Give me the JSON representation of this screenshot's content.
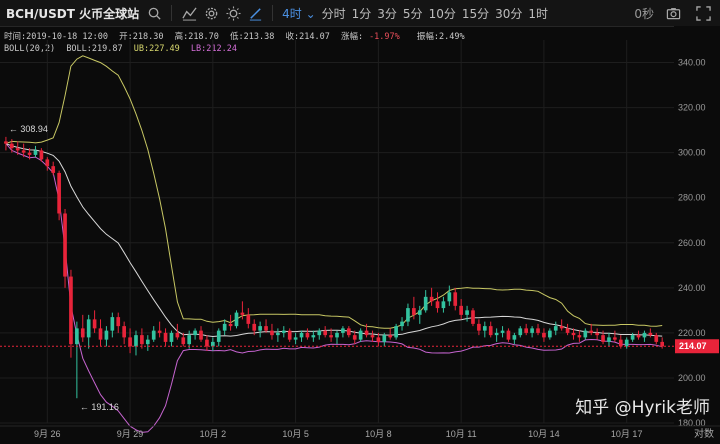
{
  "toolbar": {
    "symbol": "BCH/USDT 火币全球站",
    "intervals": [
      "4时",
      "分时",
      "1分",
      "3分",
      "5分",
      "10分",
      "15分",
      "30分",
      "1时"
    ],
    "countdown": "0秒",
    "icons": [
      "search-icon",
      "indicator-icon",
      "settings-icon",
      "theme-icon",
      "draw-icon",
      "camera-icon",
      "fullscreen-icon"
    ]
  },
  "info": {
    "time": "时间:2019-10-18 12:00",
    "open": "开:218.30",
    "high": "高:218.70",
    "low": "低:213.38",
    "close": "收:214.07",
    "change_label": "涨幅:",
    "change_value": "-1.97%",
    "amplitude": "振幅:2.49%",
    "boll_label": "BOLL(20,2)",
    "boll_mid": "BOLL:219.87",
    "boll_ub": "UB:227.49",
    "boll_lb": "LB:212.24"
  },
  "annotations": {
    "high_marker": "← 308.94",
    "low_marker": "← 191.16"
  },
  "current_price": "214.07",
  "watermark": "知乎 @Hyrik老师",
  "scale_button": "对数",
  "colors": {
    "up": "#33c3a0",
    "down": "#e8243a",
    "ub": "#c8c864",
    "lb": "#c664d0",
    "mid": "#d8d8d8",
    "active": "#4a90e2"
  },
  "chart_data": {
    "type": "candlestick",
    "ylim": [
      180,
      350
    ],
    "y_ticks": [
      "340.00",
      "320.00",
      "300.00",
      "280.00",
      "260.00",
      "240.00",
      "220.00",
      "200.00",
      "180.00"
    ],
    "x_labels": [
      "9月 26",
      "9月 29",
      "10月 2",
      "10月 5",
      "10月 8",
      "10月 11",
      "10月 14",
      "10月 17"
    ],
    "ohlc": [
      [
        305,
        307,
        301,
        304
      ],
      [
        304,
        306,
        300,
        302
      ],
      [
        302,
        305,
        299,
        301
      ],
      [
        301,
        304,
        298,
        300
      ],
      [
        300,
        302,
        297,
        299
      ],
      [
        299,
        303,
        298,
        301
      ],
      [
        301,
        302,
        296,
        297
      ],
      [
        297,
        298,
        292,
        294
      ],
      [
        294,
        296,
        290,
        291
      ],
      [
        291,
        292,
        270,
        273
      ],
      [
        273,
        275,
        240,
        245
      ],
      [
        245,
        248,
        209,
        215
      ],
      [
        215,
        225,
        191,
        222
      ],
      [
        222,
        228,
        216,
        218
      ],
      [
        218,
        228,
        213,
        226
      ],
      [
        226,
        230,
        220,
        222
      ],
      [
        222,
        226,
        214,
        217
      ],
      [
        217,
        223,
        214,
        221
      ],
      [
        221,
        229,
        218,
        227
      ],
      [
        227,
        229,
        220,
        223
      ],
      [
        223,
        225,
        215,
        218
      ],
      [
        218,
        222,
        211,
        214
      ],
      [
        214,
        221,
        210,
        219
      ],
      [
        219,
        222,
        213,
        215
      ],
      [
        215,
        219,
        212,
        217
      ],
      [
        217,
        223,
        216,
        221
      ],
      [
        221,
        225,
        218,
        220
      ],
      [
        220,
        222,
        214,
        216
      ],
      [
        216,
        221,
        214,
        220
      ],
      [
        220,
        224,
        217,
        218
      ],
      [
        218,
        220,
        214,
        215
      ],
      [
        215,
        221,
        213,
        219
      ],
      [
        219,
        222,
        217,
        221
      ],
      [
        221,
        223,
        216,
        217
      ],
      [
        217,
        219,
        212,
        214
      ],
      [
        214,
        218,
        212,
        216
      ],
      [
        216,
        222,
        214,
        221
      ],
      [
        221,
        226,
        219,
        224
      ],
      [
        224,
        228,
        221,
        223
      ],
      [
        223,
        230,
        222,
        229
      ],
      [
        229,
        234,
        226,
        228
      ],
      [
        228,
        231,
        222,
        224
      ],
      [
        224,
        226,
        219,
        221
      ],
      [
        221,
        225,
        218,
        223
      ],
      [
        223,
        226,
        220,
        221
      ],
      [
        221,
        224,
        217,
        219
      ],
      [
        219,
        222,
        216,
        220
      ],
      [
        220,
        223,
        218,
        221
      ],
      [
        221,
        222,
        216,
        217
      ],
      [
        217,
        220,
        215,
        218
      ],
      [
        218,
        221,
        216,
        220
      ],
      [
        220,
        222,
        217,
        218
      ],
      [
        218,
        221,
        216,
        219
      ],
      [
        219,
        222,
        217,
        221
      ],
      [
        221,
        223,
        218,
        219
      ],
      [
        219,
        222,
        216,
        218
      ],
      [
        218,
        221,
        215,
        220
      ],
      [
        220,
        223,
        218,
        222
      ],
      [
        222,
        223,
        218,
        219
      ],
      [
        219,
        221,
        215,
        217
      ],
      [
        217,
        222,
        216,
        221
      ],
      [
        221,
        224,
        218,
        219
      ],
      [
        219,
        221,
        216,
        218
      ],
      [
        218,
        220,
        214,
        216
      ],
      [
        216,
        220,
        214,
        219
      ],
      [
        219,
        222,
        217,
        218
      ],
      [
        218,
        224,
        217,
        223
      ],
      [
        223,
        227,
        221,
        225
      ],
      [
        225,
        233,
        223,
        231
      ],
      [
        231,
        236,
        226,
        228
      ],
      [
        228,
        232,
        224,
        230
      ],
      [
        230,
        239,
        229,
        236
      ],
      [
        236,
        240,
        232,
        234
      ],
      [
        234,
        238,
        229,
        231
      ],
      [
        231,
        236,
        229,
        234
      ],
      [
        234,
        241,
        232,
        238
      ],
      [
        238,
        240,
        230,
        232
      ],
      [
        232,
        235,
        226,
        228
      ],
      [
        228,
        232,
        225,
        230
      ],
      [
        230,
        231,
        223,
        224
      ],
      [
        224,
        226,
        219,
        221
      ],
      [
        221,
        225,
        218,
        223
      ],
      [
        223,
        225,
        218,
        219
      ],
      [
        219,
        222,
        216,
        220
      ],
      [
        220,
        223,
        218,
        221
      ],
      [
        221,
        222,
        216,
        217
      ],
      [
        217,
        220,
        215,
        219
      ],
      [
        219,
        223,
        218,
        222
      ],
      [
        222,
        224,
        219,
        220
      ],
      [
        220,
        223,
        218,
        222
      ],
      [
        222,
        224,
        219,
        220
      ],
      [
        220,
        222,
        216,
        218
      ],
      [
        218,
        222,
        217,
        221
      ],
      [
        221,
        225,
        219,
        223
      ],
      [
        223,
        226,
        221,
        222
      ],
      [
        222,
        224,
        219,
        220
      ],
      [
        220,
        222,
        217,
        219
      ],
      [
        219,
        221,
        216,
        218
      ],
      [
        218,
        222,
        217,
        221
      ],
      [
        221,
        224,
        219,
        220
      ],
      [
        220,
        222,
        217,
        219
      ],
      [
        219,
        221,
        215,
        216
      ],
      [
        216,
        220,
        214,
        218
      ],
      [
        218,
        221,
        216,
        217
      ],
      [
        217,
        219,
        213,
        214
      ],
      [
        214,
        218,
        213,
        217
      ],
      [
        217,
        220,
        216,
        219
      ],
      [
        219,
        221,
        217,
        218
      ],
      [
        218,
        221,
        216,
        220
      ],
      [
        220,
        222,
        218,
        219
      ],
      [
        219,
        220,
        215,
        216
      ],
      [
        216,
        218,
        213,
        214
      ]
    ]
  }
}
